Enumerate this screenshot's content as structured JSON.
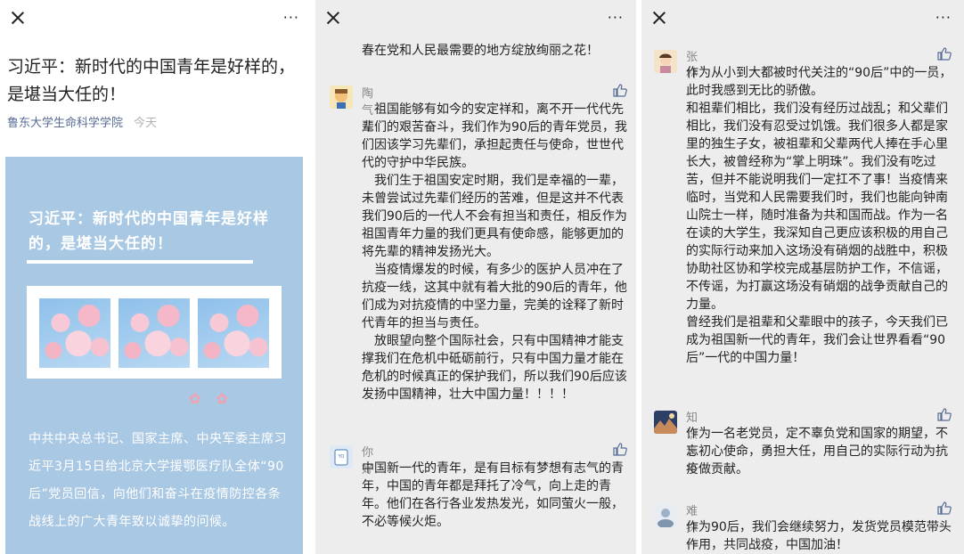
{
  "panel1": {
    "title": "习近平：新时代的中国青年是好样的，是堪当大任的！",
    "source": "鲁东大学生命科学学院",
    "date": "今天",
    "card": {
      "title": "习近平：新时代的中国青年是好样的，是堪当大任的！",
      "body": "中共中央总书记、国家主席、中央军委主席习近平3月15日给北京大学援鄂医疗队全体“90后”党员回信，向他们和奋斗在疫情防控各条战线上的广大青年致以诚挚的问候。"
    }
  },
  "panel2": {
    "top_text": "春在党和人民最需要的地方绽放绚丽之花！",
    "comments": [
      {
        "name": "陶气儿",
        "text": "　祖国能够有如今的安定祥和，离不开一代代先辈们的艰苦奋斗，我们作为90后的青年党员，我们因该学习先辈们，承担起责任与使命，世世代代的守护中华民族。\n　我们生于祖国安定时期，我们是幸福的一辈，未曾尝试过先辈们经历的苦难，但是这并不代表我们90后的一代人不会有担当和责任，相反作为祖国青年力量的我们更具有使命感，能够更加的将先辈的精神发扬光大。\n　当疫情爆发的时候，有多少的医护人员冲在了抗疫一线，这其中就有着大批的90后的青年，他们成为对抗疫情的中坚力量，完美的诠释了新时代青年的担当与责任。\n　放眼望向整个国际社会，只有中国精神才能支撑我们在危机中砥砺前行，只有中国力量才能在危机的时候真正的保护我们，所以我们90后应该发扬中国精神，壮大中国力量！！！！"
      },
      {
        "name": "你好",
        "text": "中国新一代的青年，是有目标有梦想有志气的青年，中国的青年都是拜托了冷气，向上走的青年。他们在各行各业发热发光，如同萤火一般，不必等候火炬。"
      }
    ]
  },
  "panel3": {
    "comments": [
      {
        "name": "张林",
        "text": "作为从小到大都被时代关注的“90后”中的一员，此时我感到无比的骄傲。\n和祖辈们相比，我们没有经历过战乱；和父辈们相比，我们没有忍受过饥饿。我们很多人都是家里的独生子女，被祖辈和父辈两代人捧在手心里长大，被曾经称为“掌上明珠”。我们没有吃过苦，但并不能说明我们一定扛不了事！当疫情来临时，当党和人民需要我们时，我们也能向钟南山院士一样，随时准备为共和国而战。作为一名在读的大学生，我深知自己更应该积极的用自己的实际行动来加入这场没有硝烟的战胜中，积极协助社区协和学校完成基层防护工作，不信谣，不传谣，为打赢这场没有硝烟的战争贡献自己的力量。\n曾经我们是祖辈和父辈眼中的孩子，今天我们已成为祖国新一代的青年，我们会让世界看看“90后”一代的中国力量！"
      },
      {
        "name": "知识青年",
        "text": "作为一名老党员，定不辜负党和国家的期望，不忘初心使命，勇担大任，用自己的实际行动为抗疫做贡献。"
      },
      {
        "name": "难抹一涵",
        "text": "作为90后，我们会继续努力，发货党员模范带头作用，共同战疫，中国加油！"
      }
    ]
  },
  "ui": {
    "more_label": "···",
    "flowers": "✿ ✿"
  },
  "colors": {
    "link": "#576b95",
    "card_bg": "#a9c8e4",
    "panel_bg": "#ededed"
  }
}
